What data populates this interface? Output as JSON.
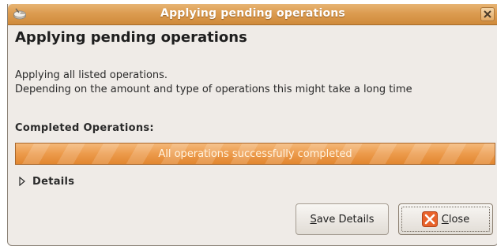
{
  "window": {
    "title": "Applying pending operations",
    "icons": {
      "app": "partition-tool-icon",
      "close": "close-icon"
    }
  },
  "content": {
    "heading": "Applying pending operations",
    "description_line1": "Applying all listed operations.",
    "description_line2": "Depending on the amount and type of operations this might take a long time",
    "completed_label": "Completed Operations:",
    "progress": {
      "fraction": 1.0,
      "text": "All operations successfully completed"
    },
    "details_label": "Details"
  },
  "buttons": {
    "save_details": {
      "mnemonic": "S",
      "rest": "ave Details"
    },
    "close": {
      "mnemonic": "C",
      "rest": "lose",
      "icon": "close-x-icon"
    }
  },
  "colors": {
    "titlebar": "#dc9c50",
    "progress_fill": "#ec9a4b",
    "window_bg": "#efebe7",
    "close_icon": "#e8622a"
  }
}
